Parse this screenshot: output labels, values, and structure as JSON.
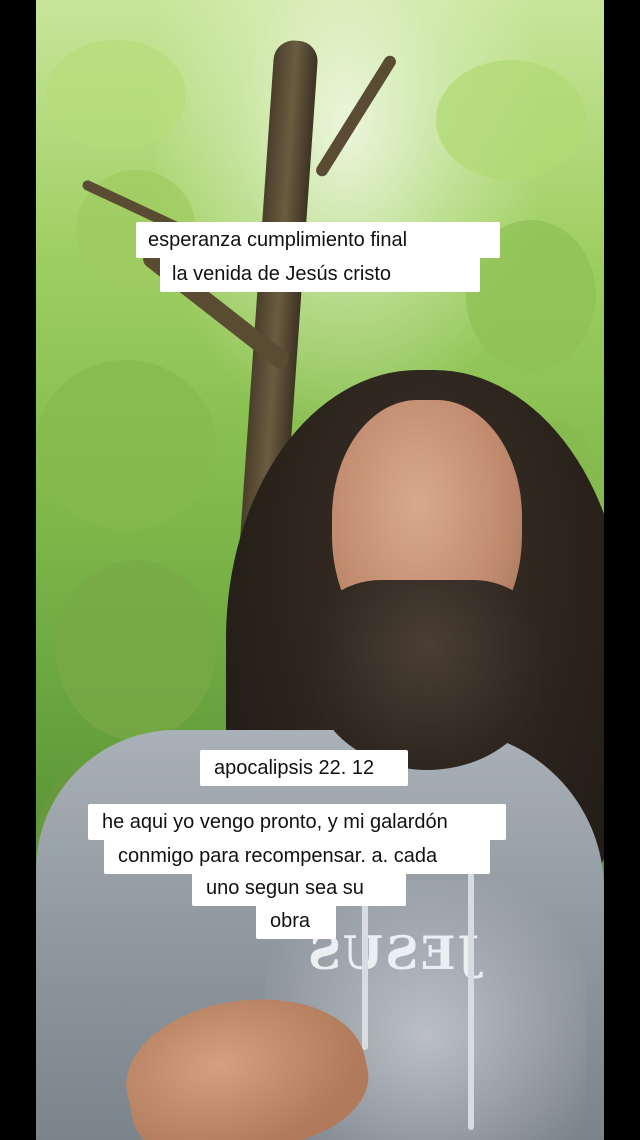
{
  "top_caption": {
    "line1": "esperanza  cumplimiento final",
    "line2": "la  venida de Jesús cristo"
  },
  "verse_caption": {
    "reference": "apocalipsis 22. 12",
    "line1": "he aqui yo vengo pronto, y mi galardón",
    "line2": "conmigo para recompensar. a. cada",
    "line3": "uno  segun sea su",
    "line4": "obra"
  },
  "shirt_print": {
    "text": "JESUS"
  }
}
